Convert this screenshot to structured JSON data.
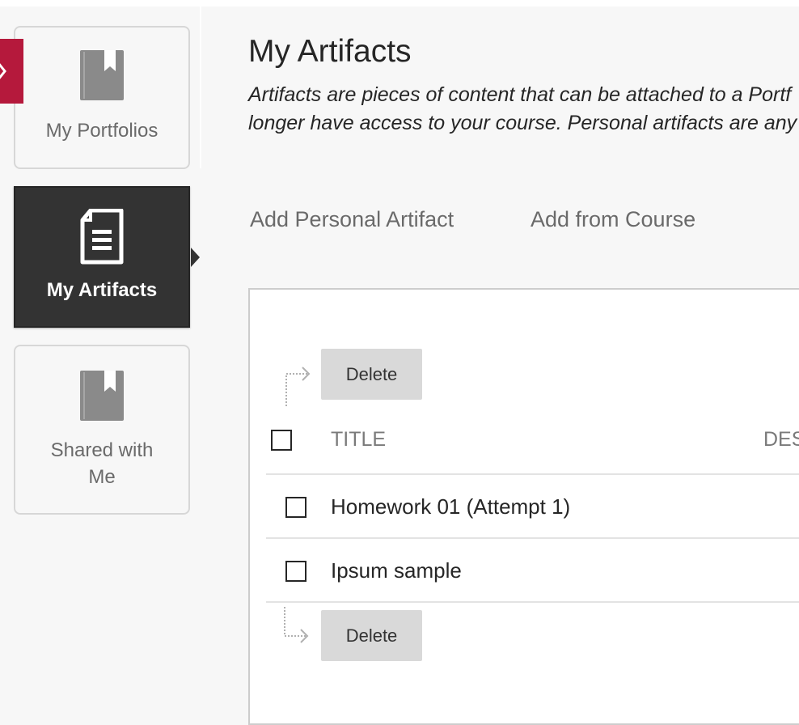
{
  "sidebar": {
    "items": [
      {
        "label": "My Portfolios",
        "icon": "bookmark-book-icon",
        "active": false
      },
      {
        "label": "My Artifacts",
        "icon": "document-icon",
        "active": true
      },
      {
        "label_line1": "Shared with",
        "label_line2": "Me",
        "icon": "bookmark-book-icon",
        "active": false
      }
    ]
  },
  "collapse_icon": "close-icon",
  "main": {
    "title": "My Artifacts",
    "description_line1": "Artifacts are pieces of content that can be attached to a Portf",
    "description_line2": "longer have access to your course. Personal artifacts are any",
    "actions": [
      "Add Personal Artifact",
      "Add from Course"
    ]
  },
  "table": {
    "delete_label": "Delete",
    "columns": [
      "TITLE",
      "DES"
    ],
    "rows": [
      {
        "title": "Homework 01 (Attempt 1)"
      },
      {
        "title": "Ipsum sample"
      }
    ]
  },
  "colors": {
    "accent": "#b5193c",
    "active_nav_bg": "#333333",
    "page_bg": "#f7f7f7",
    "button_bg": "#d9d9d9"
  }
}
